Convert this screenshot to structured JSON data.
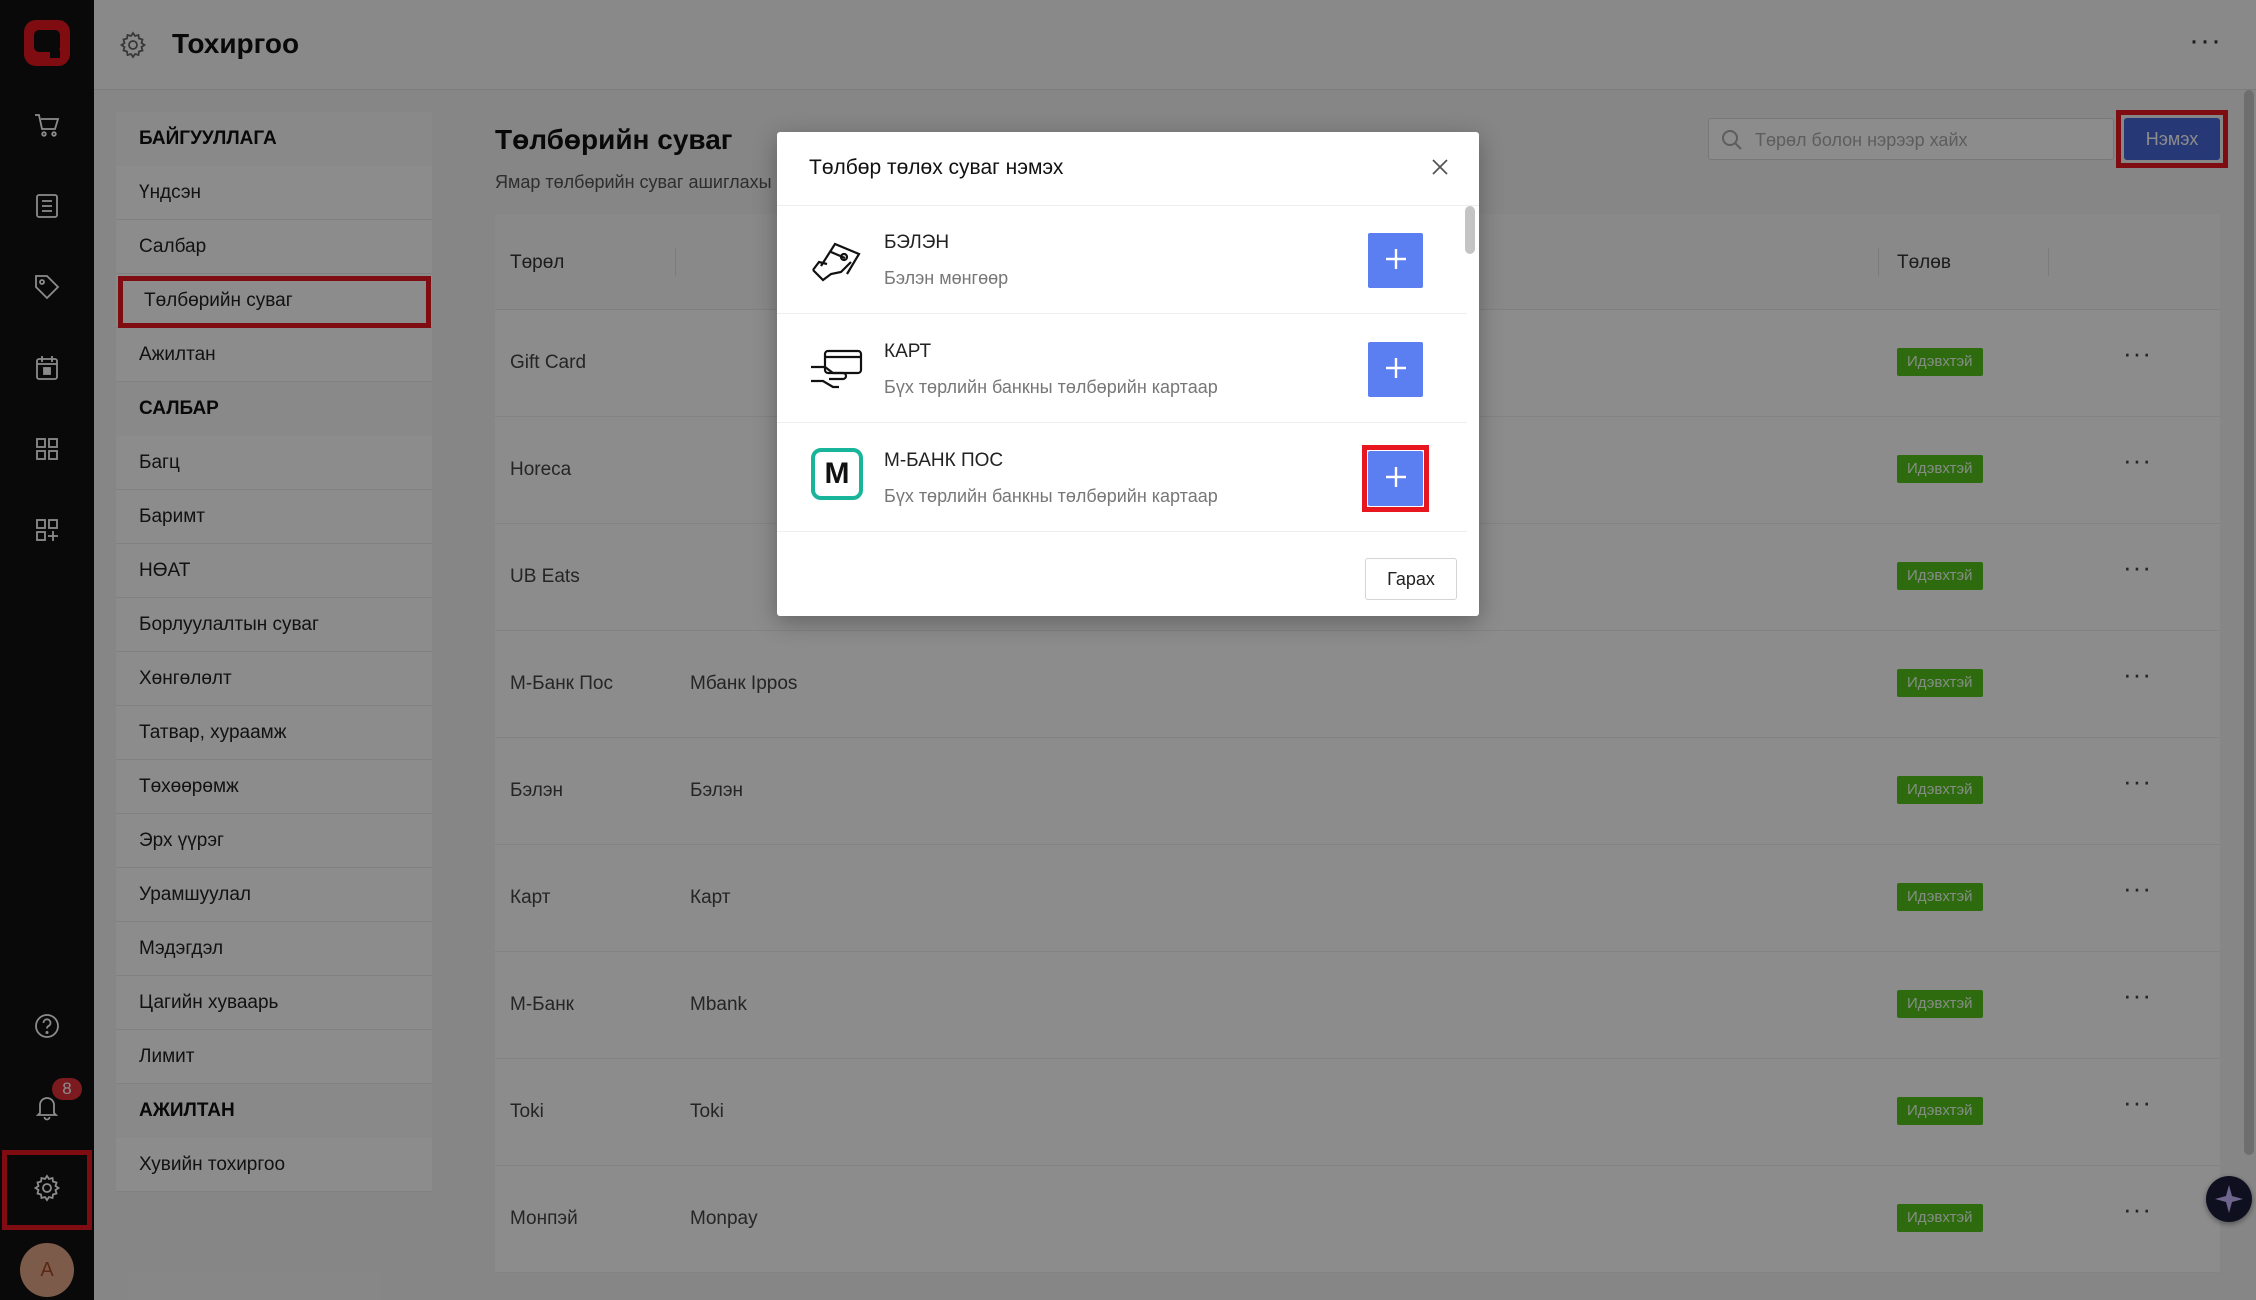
{
  "header": {
    "title": "Тохиргоо"
  },
  "badges": {
    "notifications": "8"
  },
  "user": {
    "avatar_letter": "A"
  },
  "settings_nav": {
    "groups": [
      {
        "label": "БАЙГУУЛЛАГА",
        "items": [
          "Үндсэн",
          "Салбар",
          "Төлбөрийн суваг",
          "Ажилтан"
        ]
      },
      {
        "label": "САЛБАР",
        "items": [
          "Багц",
          "Баримт",
          "НӨАТ",
          "Борлуулалтын суваг",
          "Хөнгөлөлт",
          "Татвар, хураамж",
          "Төхөөрөмж",
          "Эрх үүрэг",
          "Урамшуулал",
          "Мэдэгдэл",
          "Цагийн хуваарь",
          "Лимит"
        ]
      },
      {
        "label": "АЖИЛТАН",
        "items": [
          "Хувийн тохиргоо"
        ]
      }
    ],
    "active": "Төлбөрийн суваг"
  },
  "main": {
    "title": "Төлбөрийн суваг",
    "description": "Ямар төлбөрийн суваг ашиглахы",
    "search_placeholder": "Төрөл болон нэрээр хайх",
    "add_label": "Нэмэх",
    "columns": {
      "type": "Төрөл",
      "status": "Төлөв"
    },
    "rows": [
      {
        "type": "Gift Card",
        "name": "",
        "status": "Идэвхтэй"
      },
      {
        "type": "Horeca",
        "name": "",
        "status": "Идэвхтэй"
      },
      {
        "type": "UB Eats",
        "name": "",
        "status": "Идэвхтэй"
      },
      {
        "type": "М-Банк Пос",
        "name": "Мбанк Ippos",
        "status": "Идэвхтэй"
      },
      {
        "type": "Бэлэн",
        "name": "Бэлэн",
        "status": "Идэвхтэй"
      },
      {
        "type": "Карт",
        "name": "Карт",
        "status": "Идэвхтэй"
      },
      {
        "type": "М-Банк",
        "name": "Mbank",
        "status": "Идэвхтэй"
      },
      {
        "type": "Toki",
        "name": "Toki",
        "status": "Идэвхтэй"
      },
      {
        "type": "Монпэй",
        "name": "Monpay",
        "status": "Идэвхтэй"
      }
    ]
  },
  "modal": {
    "title": "Төлбөр төлөх суваг нэмэх",
    "items": [
      {
        "title": "БЭЛЭН",
        "subtitle": "Бэлэн мөнгөөр",
        "icon": "cash-hand-icon"
      },
      {
        "title": "КАРТ",
        "subtitle": "Бүх төрлийн банкны төлбөрийн картаар",
        "icon": "card-hand-icon"
      },
      {
        "title": "М-БАНК ПОС",
        "subtitle": "Бүх төрлийн банкны төлбөрийн картаар",
        "icon": "mbank-logo",
        "logo_letter": "M"
      }
    ],
    "back_label": "Гарах"
  },
  "colors": {
    "accent": "#4666d6",
    "plus": "#5b7ef0",
    "active_tag": "#52c41a",
    "highlight": "#e8161e",
    "brand": "#e8161e"
  }
}
